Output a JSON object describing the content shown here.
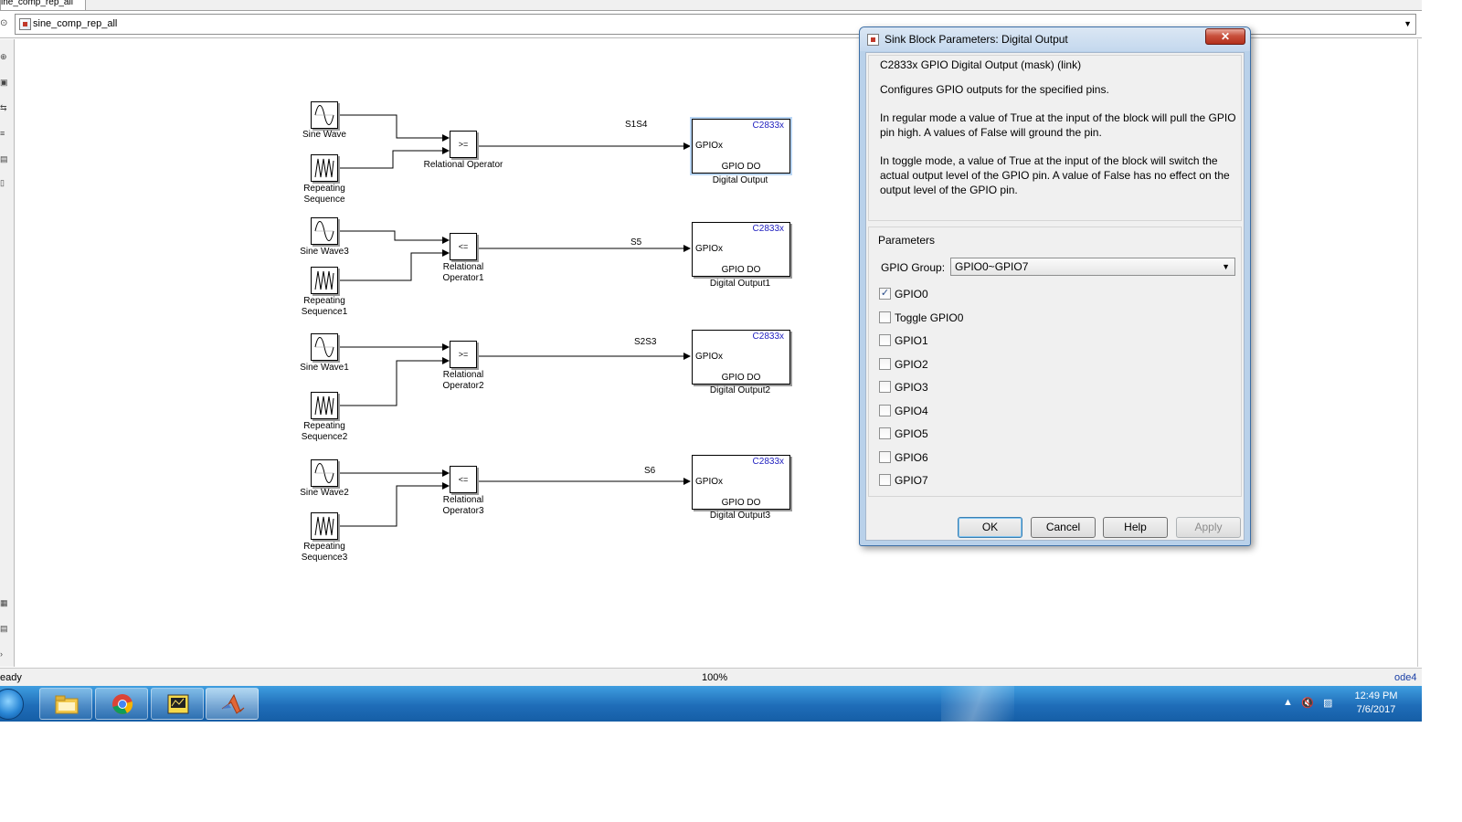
{
  "window": {
    "tab_title": "ine_comp_rep_all",
    "address": "sine_comp_rep_all"
  },
  "model": {
    "rows": [
      {
        "sine_name": "Sine Wave",
        "repeat_name": "Repeating Sequence",
        "operator_symbol": ">=",
        "operator_name": "Relational Operator",
        "signal_label": "S1S4",
        "output_tag": "C2833x",
        "output_port": "GPIOx",
        "output_text": "GPIO DO",
        "output_name": "Digital Output"
      },
      {
        "sine_name": "Sine Wave3",
        "repeat_name": "Repeating Sequence1",
        "operator_symbol": "<=",
        "operator_name": "Relational Operator1",
        "signal_label": "S5",
        "output_tag": "C2833x",
        "output_port": "GPIOx",
        "output_text": "GPIO DO",
        "output_name": "Digital Output1"
      },
      {
        "sine_name": "Sine Wave1",
        "repeat_name": "Repeating Sequence2",
        "operator_symbol": ">=",
        "operator_name": "Relational Operator2",
        "signal_label": "S2S3",
        "output_tag": "C2833x",
        "output_port": "GPIOx",
        "output_text": "GPIO DO",
        "output_name": "Digital Output2"
      },
      {
        "sine_name": "Sine Wave2",
        "repeat_name": "Repeating Sequence3",
        "operator_symbol": "<=",
        "operator_name": "Relational Operator3",
        "signal_label": "S6",
        "output_tag": "C2833x",
        "output_port": "GPIOx",
        "output_text": "GPIO DO",
        "output_name": "Digital Output3"
      }
    ]
  },
  "statusbar": {
    "status": "eady",
    "zoom": "100%",
    "solver": "ode4"
  },
  "taskbar": {
    "time": "12:49 PM",
    "date": "7/6/2017",
    "items": [
      "file-explorer-icon",
      "chrome-icon",
      "labview-icon",
      "matlab-icon"
    ]
  },
  "dialog": {
    "title": "Sink Block Parameters: Digital Output",
    "close_label": "✕",
    "mask_header": "C2833x GPIO Digital Output (mask) (link)",
    "description": [
      "Configures GPIO outputs for the specified pins.",
      "In regular mode a value of True at the input of the block will pull the GPIO pin high. A values of False will ground the pin.",
      "In toggle mode, a value of True at the input of the block will switch the actual output level of the GPIO pin. A value of False has no effect on the output level of the GPIO pin."
    ],
    "parameters_header": "Parameters",
    "gpio_group_label": "GPIO Group:",
    "gpio_group_value": "GPIO0~GPIO7",
    "checkboxes": [
      {
        "label": "GPIO0",
        "checked": true
      },
      {
        "label": "Toggle GPIO0",
        "checked": false
      },
      {
        "label": "GPIO1",
        "checked": false
      },
      {
        "label": "GPIO2",
        "checked": false
      },
      {
        "label": "GPIO3",
        "checked": false
      },
      {
        "label": "GPIO4",
        "checked": false
      },
      {
        "label": "GPIO5",
        "checked": false
      },
      {
        "label": "GPIO6",
        "checked": false
      },
      {
        "label": "GPIO7",
        "checked": false
      }
    ],
    "buttons": {
      "ok": "OK",
      "cancel": "Cancel",
      "help": "Help",
      "apply": "Apply"
    }
  },
  "colors": {
    "block_tag": "#1f1fbf",
    "solver_text": "#1a3fa6",
    "taskbar": "#1f6db8",
    "dialog_frame": "#b9d1ea"
  }
}
